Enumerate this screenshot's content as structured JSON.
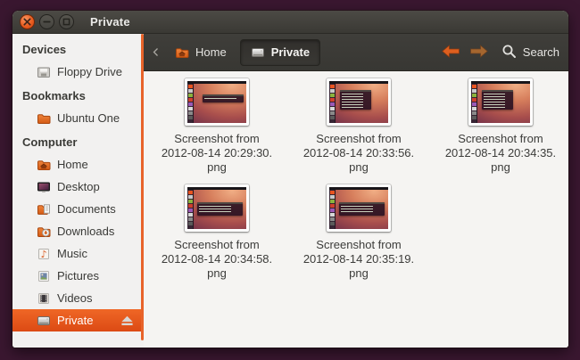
{
  "window": {
    "title": "Private"
  },
  "titlebar": {
    "buttons": [
      {
        "name": "close-button",
        "icon": "close-icon"
      },
      {
        "name": "minimize-button",
        "icon": "minimize-icon"
      },
      {
        "name": "maximize-button",
        "icon": "maximize-icon"
      }
    ]
  },
  "toolbar": {
    "breadcrumbs": [
      {
        "label": "Home",
        "icon": "home-folder-icon",
        "active": false
      },
      {
        "label": "Private",
        "icon": "drive-icon",
        "active": true
      }
    ],
    "search_label": "Search"
  },
  "sidebar": {
    "sections": [
      {
        "header": "Devices",
        "items": [
          {
            "label": "Floppy Drive",
            "icon": "floppy-icon"
          }
        ]
      },
      {
        "header": "Bookmarks",
        "items": [
          {
            "label": "Ubuntu One",
            "icon": "folder-icon"
          }
        ]
      },
      {
        "header": "Computer",
        "items": [
          {
            "label": "Home",
            "icon": "home-folder-icon"
          },
          {
            "label": "Desktop",
            "icon": "desktop-icon"
          },
          {
            "label": "Documents",
            "icon": "documents-icon"
          },
          {
            "label": "Downloads",
            "icon": "downloads-icon"
          },
          {
            "label": "Music",
            "icon": "music-icon"
          },
          {
            "label": "Pictures",
            "icon": "pictures-icon"
          },
          {
            "label": "Videos",
            "icon": "videos-icon"
          },
          {
            "label": "Private",
            "icon": "drive-icon",
            "selected": true,
            "eject": true
          }
        ]
      }
    ]
  },
  "files": [
    {
      "name": "Screenshot from 2012-08-14 20:29:30.png",
      "lines": [
        "Screenshot from",
        "2012-08-14 20:29:30.",
        "png"
      ],
      "thumb": "dialog"
    },
    {
      "name": "Screenshot from 2012-08-14 20:33:56.png",
      "lines": [
        "Screenshot from",
        "2012-08-14 20:33:56.",
        "png"
      ],
      "thumb": "terminal"
    },
    {
      "name": "Screenshot from 2012-08-14 20:34:35.png",
      "lines": [
        "Screenshot from",
        "2012-08-14 20:34:35.",
        "png"
      ],
      "thumb": "terminal"
    },
    {
      "name": "Screenshot from 2012-08-14 20:34:58.png",
      "lines": [
        "Screenshot from",
        "2012-08-14 20:34:58.",
        "png"
      ],
      "thumb": "banner"
    },
    {
      "name": "Screenshot from 2012-08-14 20:35:19.png",
      "lines": [
        "Screenshot from",
        "2012-08-14 20:35:19.",
        "png"
      ],
      "thumb": "banner"
    }
  ],
  "colors": {
    "accent_orange": "#dd4814",
    "titlebar_gray": "#3c3b37",
    "sidebar_bg": "#f2f1f0",
    "content_bg": "#f5f4f2",
    "selection_gradient_top": "#ef6726",
    "selection_gradient_bottom": "#dc4a14"
  }
}
